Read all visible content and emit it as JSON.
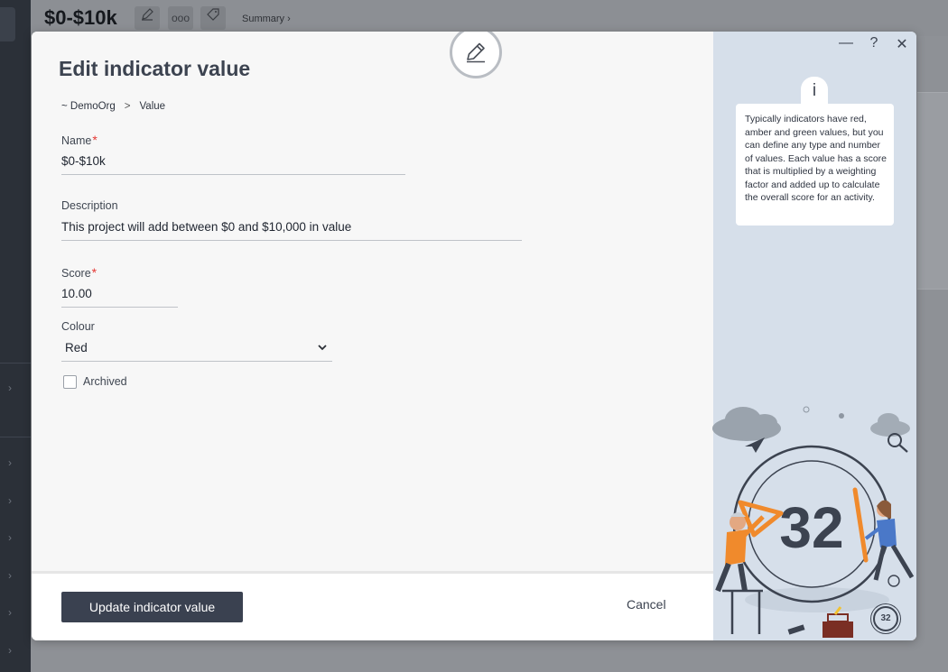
{
  "background": {
    "page_title": "$0-$10k",
    "summary_link": "Summary ›",
    "tools": [
      {
        "icon": "pencil-icon"
      },
      {
        "icon": "more-icon",
        "label": "ooo"
      },
      {
        "icon": "tag-icon"
      }
    ]
  },
  "modal": {
    "title": "Edit indicator value",
    "breadcrumb": {
      "org": "~ DemoOrg",
      "separator": ">",
      "current": "Value"
    },
    "fields": {
      "name": {
        "label": "Name",
        "value": "$0-$10k",
        "required": true
      },
      "description": {
        "label": "Description",
        "value": "This project will add between $0 and $10,000 in value"
      },
      "score": {
        "label": "Score",
        "value": "10.00",
        "required": true
      },
      "colour": {
        "label": "Colour",
        "value": "Red"
      },
      "archived": {
        "label": "Archived",
        "checked": false
      }
    },
    "required_marker": "*",
    "footer": {
      "update_label": "Update indicator value",
      "cancel_label": "Cancel"
    },
    "window_controls": {
      "minimize": "—",
      "help": "?",
      "close": "✕"
    }
  },
  "info_panel": {
    "tab_glyph": "i",
    "text": "Typically indicators have red, amber and green values, but you can define any type and number of values. Each value has a score that is multiplied by a weighting factor and added up to calculate the overall score for an activity.",
    "illustration_number": "32",
    "badge_number": "32"
  },
  "colors": {
    "accent_dark": "#3a4150",
    "required": "#e53935",
    "side_panel": "#d6dfea",
    "illustration_orange": "#f08a2c"
  }
}
